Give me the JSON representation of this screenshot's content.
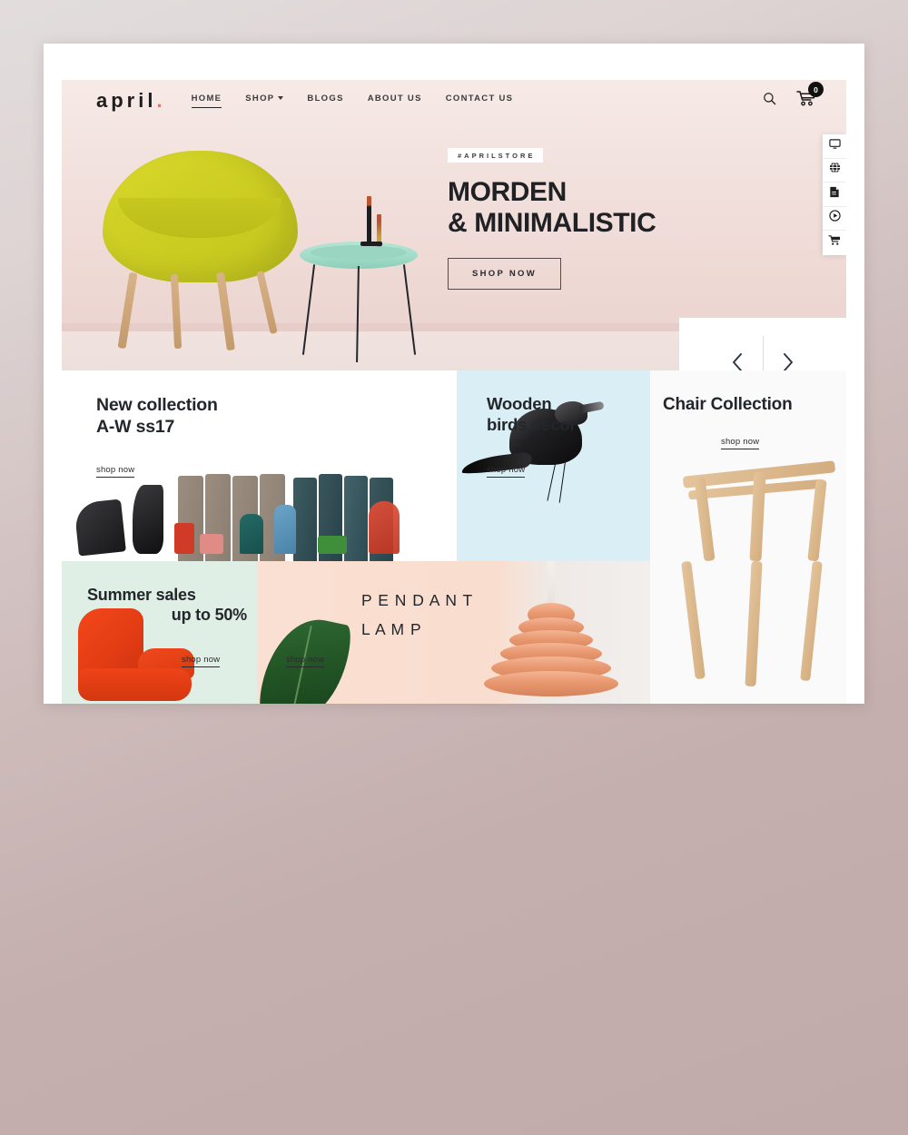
{
  "site": {
    "logo_text": "april",
    "logo_dot": "."
  },
  "nav": {
    "items": [
      {
        "label": "HOME",
        "active": true,
        "has_dropdown": false
      },
      {
        "label": "SHOP",
        "active": false,
        "has_dropdown": true
      },
      {
        "label": "BLOGS",
        "active": false,
        "has_dropdown": false
      },
      {
        "label": "ABOUT US",
        "active": false,
        "has_dropdown": false
      },
      {
        "label": "CONTACT US",
        "active": false,
        "has_dropdown": false
      }
    ],
    "search_icon": "search-icon",
    "cart_icon": "shopping-cart-icon",
    "cart_count": "0"
  },
  "hero": {
    "hashtag": "#APRILSTORE",
    "title_line1": "MORDEN",
    "title_line2": "& MINIMALISTIC",
    "cta_label": "SHOP NOW",
    "prev_icon": "chevron-left-icon",
    "next_icon": "chevron-right-icon"
  },
  "promos": {
    "collection": {
      "title_line1": "New collection",
      "title_line2": "A-W ss17",
      "link_label": "shop now",
      "bg": "#ffffff"
    },
    "birds": {
      "title_line1": "Wooden",
      "title_line2": "birds decor",
      "link_label": "shop now",
      "bg": "#d9eef5"
    },
    "chairs": {
      "title": "Chair Collection",
      "link_label": "shop now",
      "bg": "#fafafa"
    },
    "summer": {
      "title_line1": "Summer sales",
      "title_line2": "up to 50%",
      "link_label": "shop now",
      "bg": "#e0efe6"
    },
    "lamp": {
      "title_line1": "P E N D A N T",
      "title_line2": "L A M P",
      "link_label": "shop now",
      "bg": "#fae0d2"
    }
  },
  "icon_rail": {
    "items": [
      {
        "icon": "monitor-icon"
      },
      {
        "icon": "globe-icon"
      },
      {
        "icon": "document-icon"
      },
      {
        "icon": "play-circle-icon"
      },
      {
        "icon": "cart-icon"
      }
    ]
  },
  "colors": {
    "accent": "#e8736a",
    "text_dark": "#23262a",
    "hero_bg": "#f0ddd9"
  }
}
